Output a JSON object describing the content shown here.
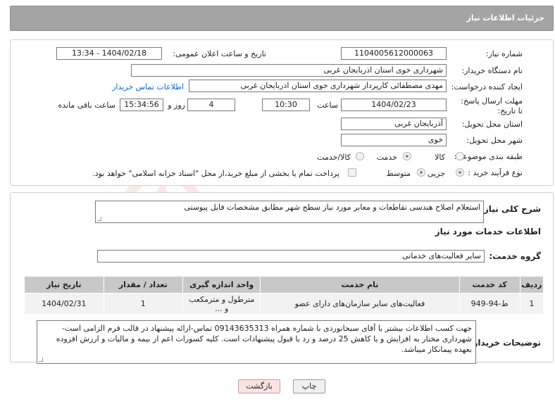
{
  "header": {
    "title": "جزئیات اطلاعات نیاز"
  },
  "form": {
    "need_number_label": "شماره نیاز:",
    "need_number": "1104005612000063",
    "announce_label": "تاریخ و ساعت اعلان عمومی:",
    "announce_value": "1404/02/18 - 13:34",
    "buyer_org_label": "نام دستگاه خریدار:",
    "buyer_org": "شهرداری خوی استان اذربایجان غربی",
    "creator_label": "ایجاد کننده درخواست:",
    "creator": "مهدی مصطفائی کارپرداز شهرداری خوی استان اذربایجان غربی",
    "buyer_contact_link": "اطلاعات تماس خریدار",
    "deadline_label": "مهلت ارسال پاسخ: تا تاریخ:",
    "deadline_date": "1404/02/23",
    "time_label": "ساعت",
    "deadline_time": "10:30",
    "days_value": "4",
    "days_label": "روز و",
    "remaining_time": "15:34:56",
    "remaining_label": "ساعت باقی مانده",
    "province_label": "استان محل تحویل:",
    "province": "آذربایجان غربی",
    "city_label": "شهر محل تحویل:",
    "city": "خوی",
    "category_label": "طبقه بندی موضوعی:",
    "category_options": [
      "کالا",
      "خدمت",
      "کالا/خدمت"
    ],
    "category_selected": "خدمت",
    "process_label": "نوع فرآیند خرید :",
    "process_options": [
      "جزیی",
      "متوسط"
    ],
    "process_selected": "جزیی",
    "payment_note": "پرداخت تمام یا بخشی از مبلغ خرید،از محل \"اسناد خزانه اسلامی\" خواهد بود."
  },
  "description": {
    "label": "شرح کلی نیاز:",
    "text": "استعلام اصلاح هندسی تقاطعات و معابر مورد نیاز سطح شهر مطابق مشخصات فایل پیوستی"
  },
  "services": {
    "section_title": "اطلاعات خدمات مورد نیاز",
    "group_label": "گروه خدمت:",
    "group_value": "سایر فعالیت‌های خدماتی",
    "table": {
      "headers": [
        "ردیف",
        "کد خدمت",
        "نام خدمت",
        "واحد اندازه گیری",
        "تعداد / مقدار",
        "تاریخ نیاز"
      ],
      "rows": [
        [
          "1",
          "ط-94-949",
          "فعالیت‌های سایر سازمان‌های دارای عضو",
          "مترطول و مترمکعب و ...",
          "1",
          "1404/02/31"
        ]
      ]
    }
  },
  "buyer_notes": {
    "label": "توضیحات خریدار:",
    "text": "جهت کسب اطلاعات بیشتر با آقای  سبحانوردی با شماره همراه 09143635313 تماس-ارائه پیشنهاد در قالب فرم الزامی است-شهرداری مختار به افزایش و یا کاهش 25 درصد و رد یا قبول پیشنهادات است. کلیه کسورات اعم از بیمه و مالیات و ارزش افزوده بعهده پیمانکار میباشد."
  },
  "buttons": {
    "print": "چاپ",
    "back": "بازگشت"
  },
  "watermark": {
    "text": "AriaTender.neT",
    "color": "#c62828"
  }
}
